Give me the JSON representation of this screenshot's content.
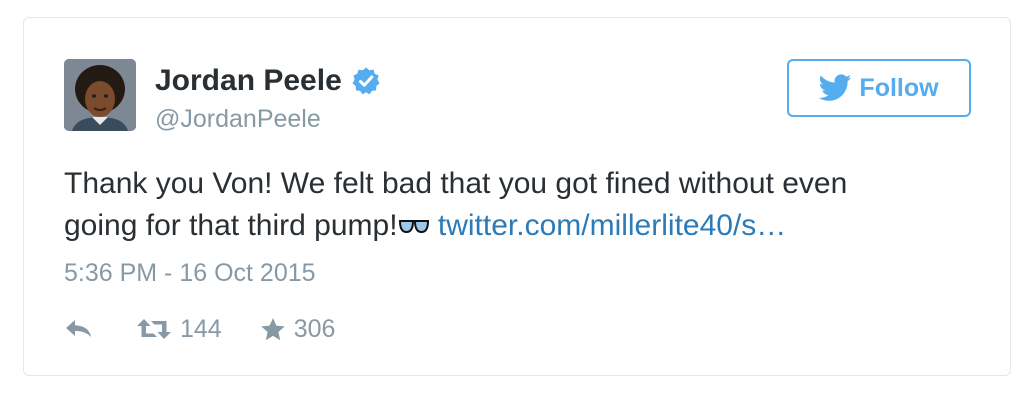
{
  "author": {
    "name": "Jordan Peele",
    "handle": "@JordanPeele",
    "verified": true,
    "avatar_icon": "child-portrait-avatar"
  },
  "follow_button": {
    "label": "Follow",
    "icon": "twitter-bird-icon"
  },
  "tweet": {
    "text_line1": "Thank you Von! We felt bad that you got fined without even",
    "text_line2_prefix": "going for that third pump!",
    "emoji_icon": "glasses-emoji",
    "link_text": "twitter.com/millerlite40/s…",
    "timestamp": "5:36 PM - 16 Oct 2015"
  },
  "actions": {
    "reply_icon": "reply-icon",
    "retweet_icon": "retweet-icon",
    "retweet_count": "144",
    "favorite_icon": "star-icon",
    "favorite_count": "306"
  },
  "colors": {
    "accent": "#55acee",
    "link": "#2b7bb9",
    "text": "#292f33",
    "muted": "#8899a6",
    "border": "#e1e8ed"
  }
}
